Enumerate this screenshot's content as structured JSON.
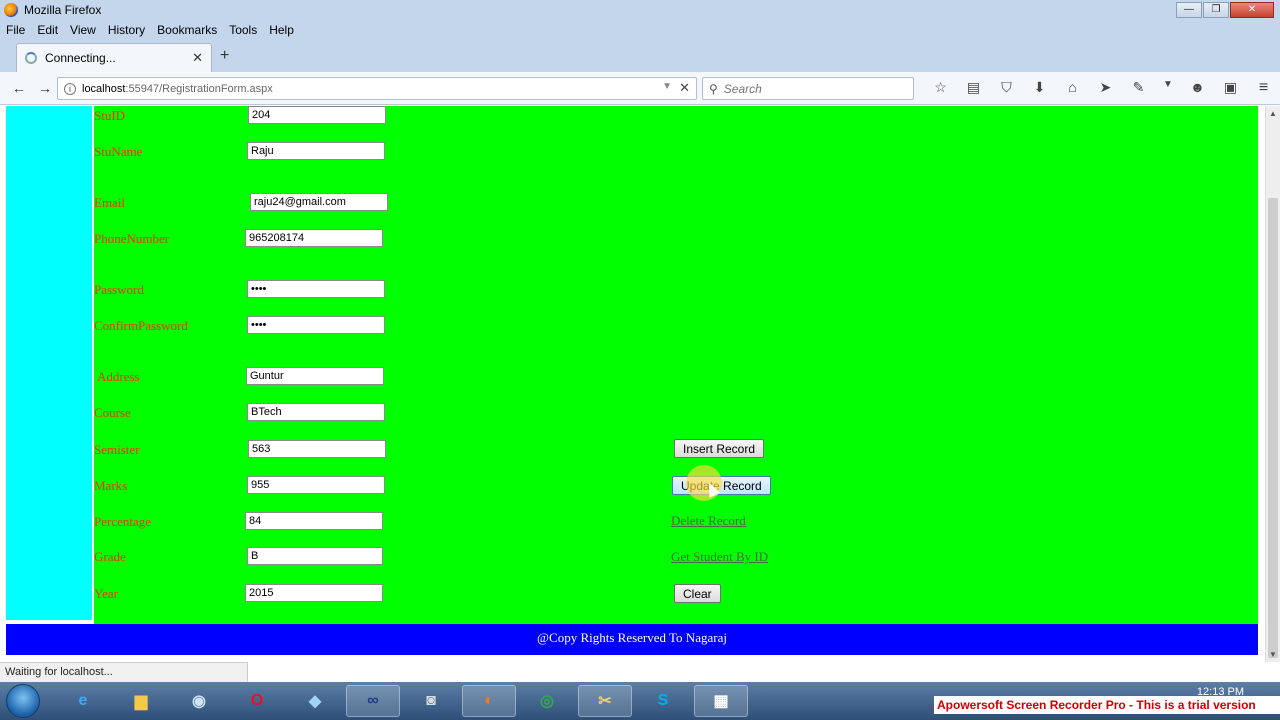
{
  "window": {
    "title": "Mozilla Firefox",
    "controls": {
      "minimize": "—",
      "maximize": "❐",
      "close": "✕"
    }
  },
  "menubar": [
    "File",
    "Edit",
    "View",
    "History",
    "Bookmarks",
    "Tools",
    "Help"
  ],
  "tab": {
    "title": "Connecting...",
    "close": "✕",
    "new_tab": "+"
  },
  "navbar": {
    "back": "←",
    "forward": "→",
    "url_host": "localhost",
    "url_path": ":55947/RegistrationForm.aspx",
    "search_placeholder": "Search",
    "toolbar_icons": [
      "star-icon",
      "reading-list-icon",
      "pocket-icon",
      "download-icon",
      "home-icon",
      "send-icon",
      "extension-icon",
      "dropdown-icon",
      "chat-icon",
      "screenshot-icon",
      "menu-icon"
    ]
  },
  "form": {
    "fields": [
      {
        "name": "stuid",
        "label": "StuID",
        "value": "204",
        "type": "text"
      },
      {
        "name": "stuname",
        "label": "StuName",
        "value": "Raju",
        "type": "text"
      },
      {
        "name": "email",
        "label": "Email",
        "value": "raju24@gmail.com",
        "type": "text"
      },
      {
        "name": "phonenumber",
        "label": "PhoneNumber",
        "value": "965208174",
        "type": "text"
      },
      {
        "name": "password",
        "label": "Password",
        "value": "••••",
        "type": "password"
      },
      {
        "name": "confirmpassword",
        "label": "ConfirmPassword",
        "value": "••••",
        "type": "password"
      },
      {
        "name": "address",
        "label": "Address",
        "value": "Guntur",
        "type": "text"
      },
      {
        "name": "course",
        "label": "Course",
        "value": "BTech",
        "type": "text"
      },
      {
        "name": "semister",
        "label": "Semister",
        "value": "563",
        "type": "text"
      },
      {
        "name": "marks",
        "label": "Marks",
        "value": "955",
        "type": "text"
      },
      {
        "name": "percentage",
        "label": "Percentage",
        "value": "84",
        "type": "text"
      },
      {
        "name": "grade",
        "label": "Grade",
        "value": "B",
        "type": "text"
      },
      {
        "name": "year",
        "label": "Year",
        "value": "2015",
        "type": "text"
      }
    ],
    "actions": {
      "insert": "Insert Record",
      "update": "Update Record",
      "delete": "Delete Record",
      "get_by_id": "Get Student By ID",
      "clear": "Clear"
    }
  },
  "footer": {
    "text": "@Copy Rights Reserved To Nagaraj"
  },
  "status": {
    "text": "Waiting for localhost..."
  },
  "taskbar": {
    "apps": [
      "internet-explorer-icon",
      "file-explorer-icon",
      "media-player-icon",
      "opera-icon",
      "app-icon",
      "app-icon",
      "camera-icon",
      "firefox-icon",
      "chrome-icon",
      "tools-icon",
      "skype-icon",
      "visual-studio-icon"
    ],
    "clock": "12:13 PM"
  },
  "watermark": {
    "text": "Apowersoft Screen Recorder Pro - This is a trial version"
  },
  "colors": {
    "left_column": "#00ffff",
    "main_panel": "#00ff00",
    "footer": "#0000ff",
    "label_text": "#ff2a00"
  }
}
